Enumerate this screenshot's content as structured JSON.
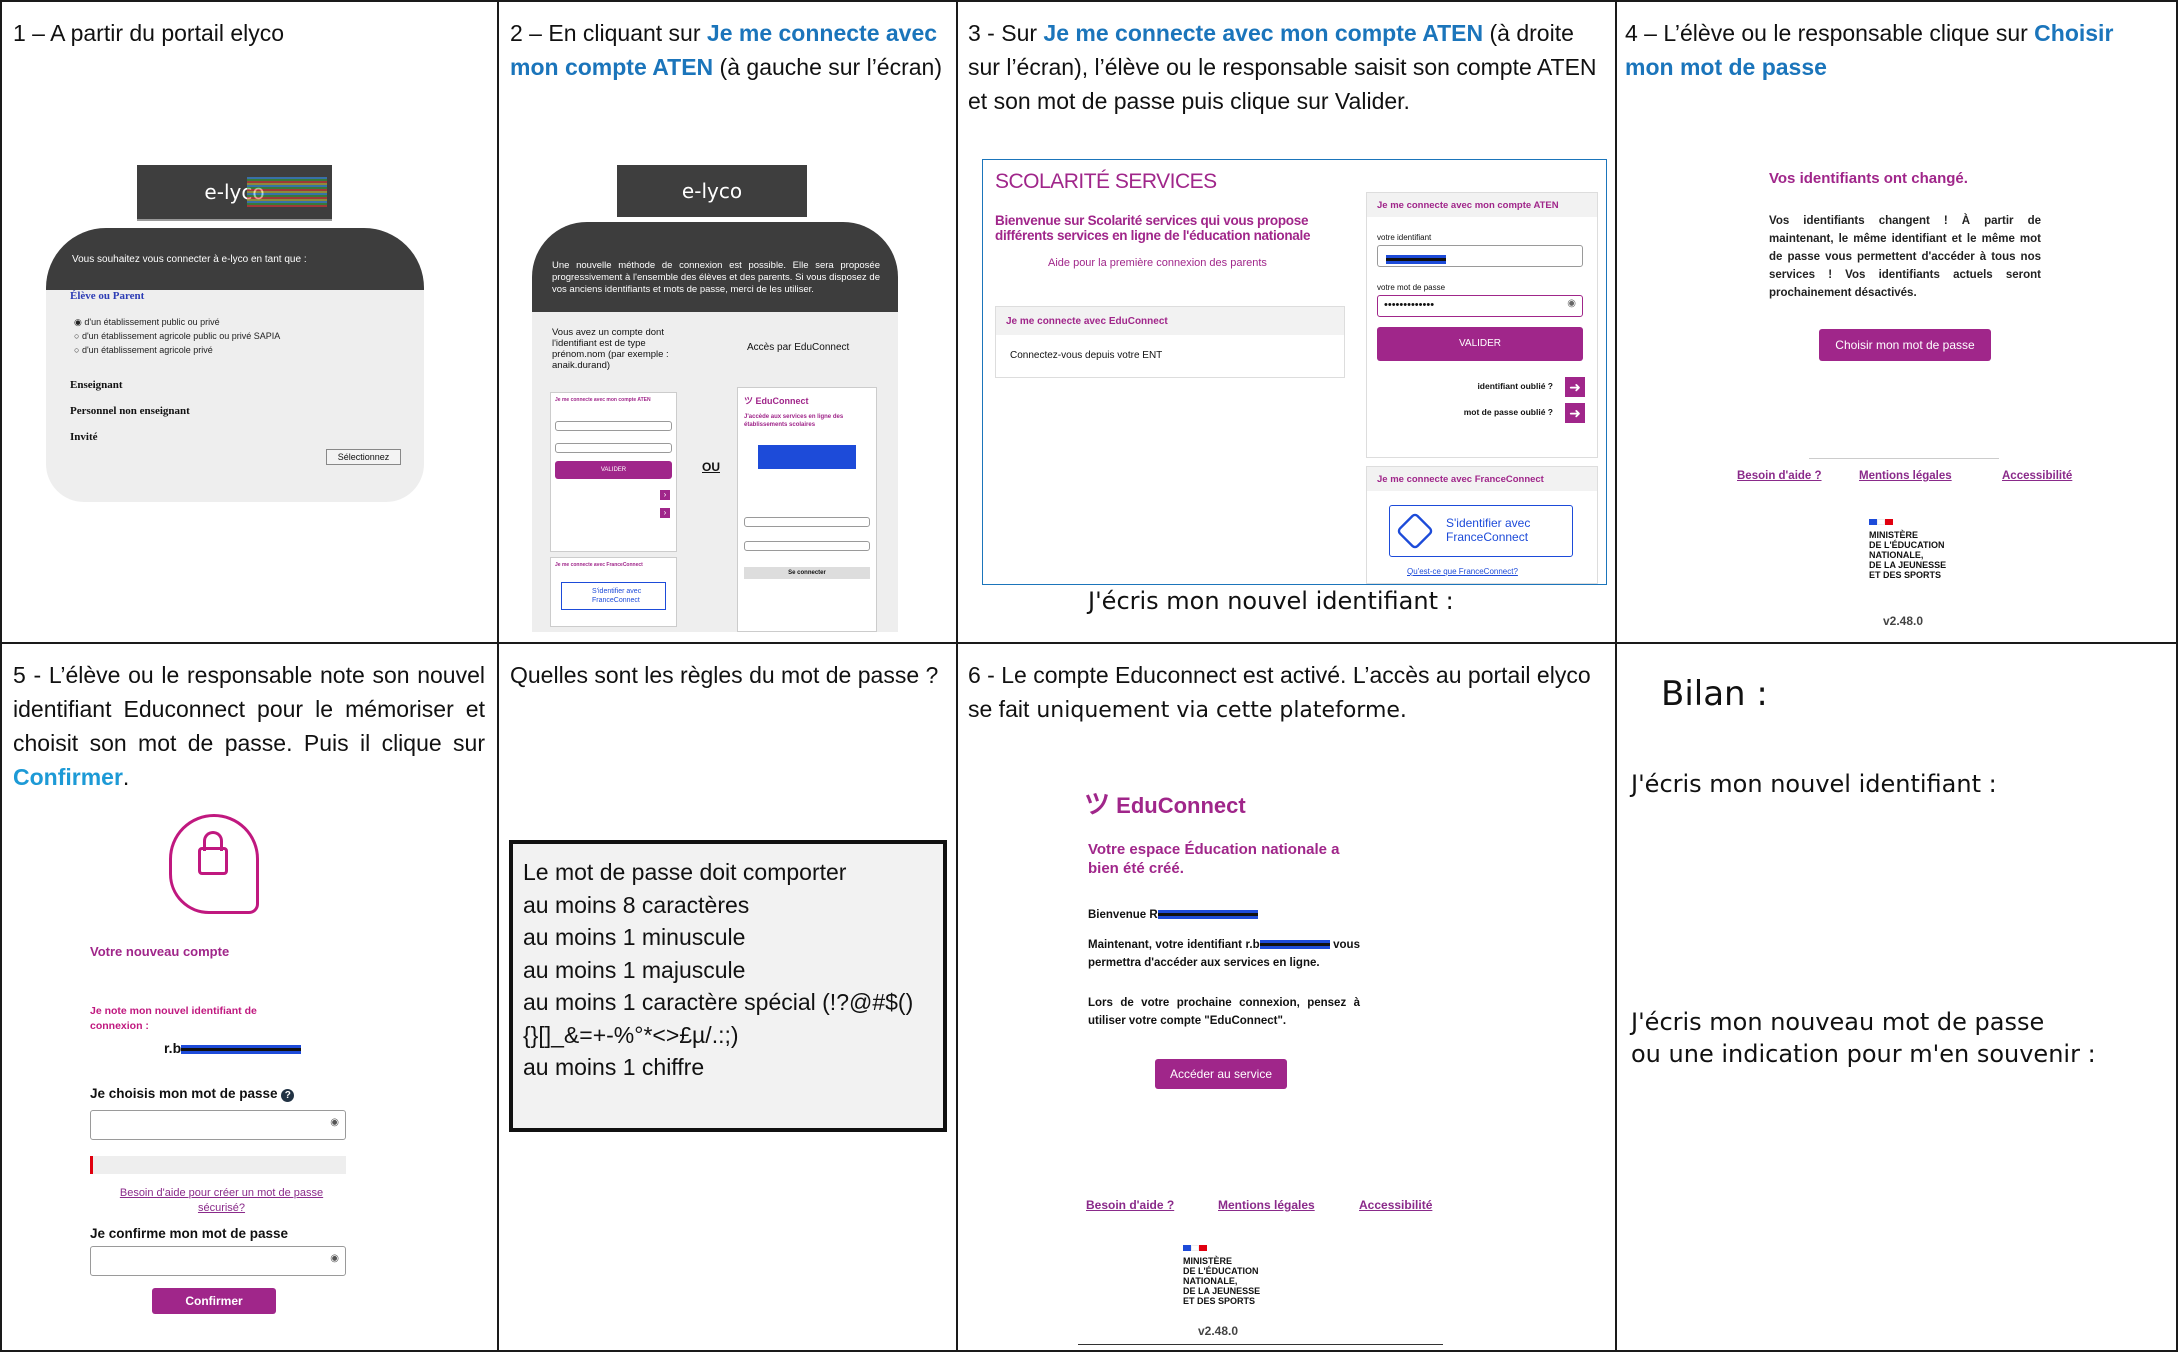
{
  "cells": {
    "c1": {
      "num": "1 – ",
      "text": "A partir du portail elyco"
    },
    "c2": {
      "prefix": "2 – En cliquant sur ",
      "highlight": "Je me connecte avec mon compte ATEN",
      "suffix": " (à gauche sur l’écran)"
    },
    "c3": {
      "prefix": "3 - Sur ",
      "highlight": "Je me connecte avec mon compte ATEN",
      "suffix": " (à droite sur l’écran), l’élève ou le responsable saisit son compte ATEN et son mot de passe puis clique sur Valider.",
      "caption": "J'écris mon nouvel identifiant :"
    },
    "c4": {
      "prefix": "4 – L’élève ou le responsable clique sur ",
      "highlight": "Choisir mon mot de passe"
    },
    "c5": {
      "prefix": "5 - L’élève ou le responsable note son nouvel identifiant Educonnect pour le mémoriser et choisit son mot de passe. Puis  il clique sur ",
      "highlight": "Confirmer",
      "suffix": "."
    },
    "c6": {
      "question": "Quelles sont les règles du mot de passe ?",
      "rules": [
        "Le mot de passe doit comporter",
        "au moins 8 caractères",
        "au moins 1 minuscule",
        "au moins 1 majuscule",
        "au moins 1 caractère spécial (!?@#$()",
        "{}[]_&=+-%°*<>£µ/.:;)",
        "au moins 1 chiffre"
      ]
    },
    "c7": {
      "prefix": "6 - Le compte Educonnect est activé. L’accès au portail elyco se fait",
      "suffix": " uniquement via cette plateforme."
    },
    "c8": {
      "title": "Bilan :",
      "line1": "J'écris mon nouvel identifiant :",
      "line2": "J'écris mon nouveau mot de passe",
      "line3": "ou une indication pour m'en souvenir :"
    }
  },
  "elyco": {
    "logo": "e-lyco",
    "prompt": "Vous souhaitez vous connecter à e-lyco en tant que :",
    "eleve": "Élève ou Parent",
    "options": [
      "d'un établissement public ou privé",
      "d'un établissement agricole public ou privé SAPIA",
      "d'un établissement agricole privé"
    ],
    "roles": [
      "Enseignant",
      "Personnel non enseignant",
      "Invité"
    ],
    "select_button": "Sélectionnez"
  },
  "elyco2": {
    "logo": "e-lyco",
    "notice": "Une nouvelle méthode de connexion est possible. Elle sera proposée progressivement à l'ensemble des élèves et des parents. Si vous disposez de vos anciens identifiants et mots de passe, merci de les utiliser.",
    "left_text": "Vous avez un compte dont l'identifiant est de type prénom.nom (par exemple : anaik.durand)",
    "right_text": "Accès par EduConnect",
    "ou": "OU",
    "aten": "Je me connecte avec mon compte ATEN",
    "valider": "VALIDER",
    "fc": "Je me connecte avec FranceConnect",
    "fc_btn": "S'identifier avec FranceConnect",
    "educonnect": "EduConnect",
    "acces": "J'accède aux services en ligne des établissements scolaires",
    "seconnecter": "Se connecter"
  },
  "scolarite": {
    "brand": "SCOLARITÉ SERVICES",
    "welcome": "Bienvenue sur Scolarité services qui vous propose différents services en ligne de l'éducation nationale",
    "aide": "Aide pour la première connexion des parents",
    "educonnect_header": "Je me connecte avec EduConnect",
    "educonnect_link": "Connectez-vous depuis votre ENT",
    "aten_header": "Je me connecte avec mon compte ATEN",
    "id_label": "votre identifiant",
    "pwd_label": "votre mot de passe",
    "pwd_value": "•••••••••••••",
    "valider": "VALIDER",
    "id_oublie": "identifiant oublié ?",
    "mdp_oublie": "mot de passe oublié ?",
    "fc_header": "Je me connecte avec FranceConnect",
    "fc_btn1": "S'identifier avec",
    "fc_btn2": "FranceConnect",
    "fc_link": "Qu'est-ce que FranceConnect?"
  },
  "changed": {
    "title": "Vos identifiants ont changé.",
    "body": "Vos identifiants changent ! À partir de maintenant, le même identifiant et le même mot de passe vous permettent d'accéder à tous nos services ! Vos identifiants actuels seront prochainement désactivés.",
    "button": "Choisir mon mot de passe",
    "links": [
      "Besoin d'aide ?",
      "Mentions légales",
      "Accessibilité"
    ],
    "ministry": [
      "MINISTÈRE",
      "DE L'ÉDUCATION",
      "NATIONALE,",
      "DE LA JEUNESSE",
      "ET DES SPORTS"
    ],
    "version": "v2.48.0"
  },
  "newaccount": {
    "title": "Votre nouveau compte",
    "note": "Je note mon nouvel identifiant de connexion :",
    "id_prefix": "r.b",
    "choose": "Je choisis mon mot de passe",
    "help": "Besoin d'aide pour créer un mot de passe sécurisé?",
    "confirm_label": "Je confirme mon mot de passe",
    "confirm_btn": "Confirmer"
  },
  "created": {
    "brand": "EduConnect",
    "title": "Votre espace Éducation nationale a bien été créé.",
    "hello": "Bienvenue R",
    "now_prefix": "Maintenant, votre identifiant r.b",
    "now_suffix": "vous permettra d'accéder aux services en ligne.",
    "next": "Lors de votre prochaine connexion, pensez à utiliser votre compte \"EduConnect\".",
    "button": "Accéder au service",
    "links": [
      "Besoin d'aide ?",
      "Mentions légales",
      "Accessibilité"
    ],
    "version": "v2.48.0"
  },
  "colors": {
    "purple": "#a0268a",
    "link_blue": "#1b75bb",
    "cyan": "#1d9ad6",
    "dark_header": "#3d3d3d"
  }
}
